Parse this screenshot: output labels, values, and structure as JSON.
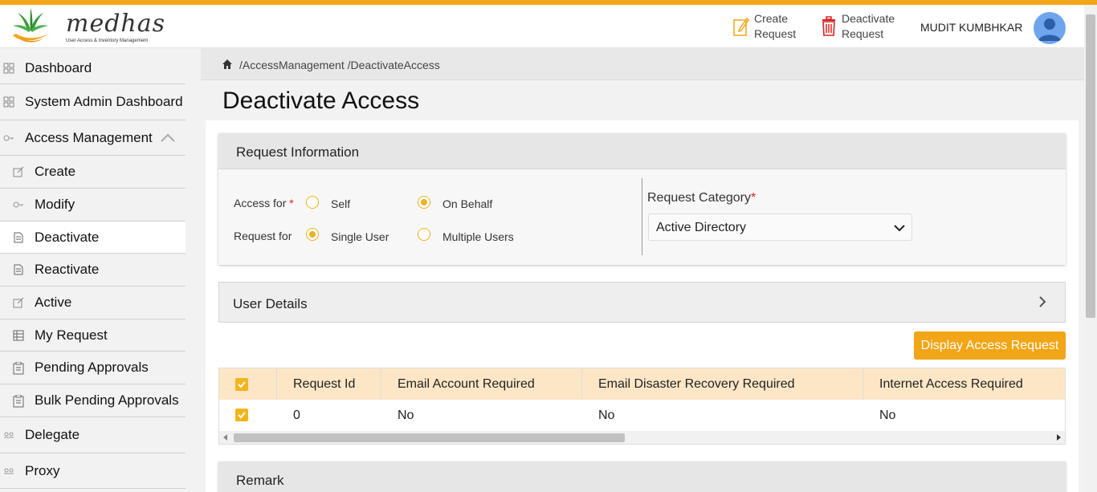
{
  "app": {
    "logo_text": "medhas",
    "logo_subtitle": "User Access & Inventory Management",
    "accent_color": "#f2a516"
  },
  "header": {
    "create_request": [
      "Create",
      "Request"
    ],
    "deactivate_request": [
      "Deactivate",
      "Request"
    ],
    "username": "MUDIT KUMBHKAR"
  },
  "sidebar": {
    "items": [
      {
        "label": "Dashboard",
        "icon": "grid-icon"
      },
      {
        "label": "System Admin Dashboard",
        "icon": "grid-icon"
      },
      {
        "label": "Access Management",
        "icon": "key-icon"
      },
      {
        "label": "Create",
        "icon": "edit-icon"
      },
      {
        "label": "Modify",
        "icon": "key-icon"
      },
      {
        "label": "Deactivate",
        "icon": "document-icon"
      },
      {
        "label": "Reactivate",
        "icon": "document-icon"
      },
      {
        "label": "Active",
        "icon": "edit-icon"
      },
      {
        "label": "My Request",
        "icon": "table-icon"
      },
      {
        "label": "Pending Approvals",
        "icon": "clipboard-icon"
      },
      {
        "label": "Bulk Pending Approvals",
        "icon": "clipboard-icon"
      },
      {
        "label": "Delegate",
        "icon": "users-icon"
      },
      {
        "label": "Proxy",
        "icon": "users-icon"
      }
    ]
  },
  "breadcrumb": "/AccessManagement /DeactivateAccess",
  "page_title": "Deactivate Access",
  "request_info": {
    "title": "Request Information",
    "access_for_label": "Access for",
    "required_mark": "*",
    "opt_self": "Self",
    "opt_on_behalf": "On Behalf",
    "request_for_label": "Request for",
    "opt_single_user": "Single User",
    "opt_multiple_users": "Multiple Users",
    "category_label": "Request Category",
    "category_value": "Active Directory"
  },
  "user_details": {
    "title": "User Details"
  },
  "display_button": "Display Access Request",
  "table": {
    "headers": [
      "Request Id",
      "Email Account Required",
      "Email Disaster Recovery Required",
      "Internet Access Required"
    ],
    "rows": [
      [
        "0",
        "No",
        "No",
        "No"
      ]
    ]
  },
  "remark": {
    "title": "Remark"
  }
}
